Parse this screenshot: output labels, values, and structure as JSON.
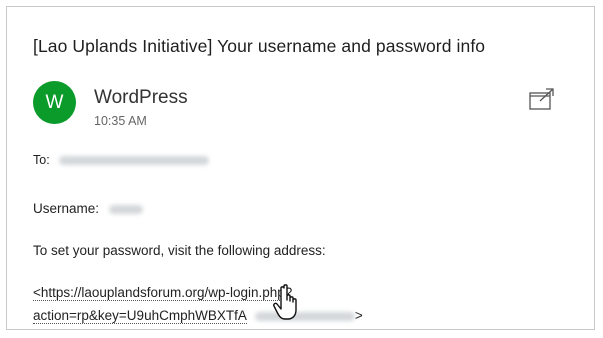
{
  "email": {
    "subject": "[Lao Uplands Initiative] Your username and password info",
    "sender": {
      "initial": "W",
      "name": "WordPress",
      "time": "10:35 AM",
      "avatar_color": "#0b9b2a"
    },
    "to_label": "To:",
    "username_label": "Username:",
    "instruction": "To set your password, visit the following address:",
    "link_line1": "<https://laouplandsforum.org/wp-login.php?",
    "link_line2_prefix": "action=rp&key=U9uhCmphWBXTfA",
    "link_line2_suffix": ">"
  },
  "icons": {
    "popout": "popout-window-icon",
    "cursor": "hand-pointer-cursor-icon"
  }
}
